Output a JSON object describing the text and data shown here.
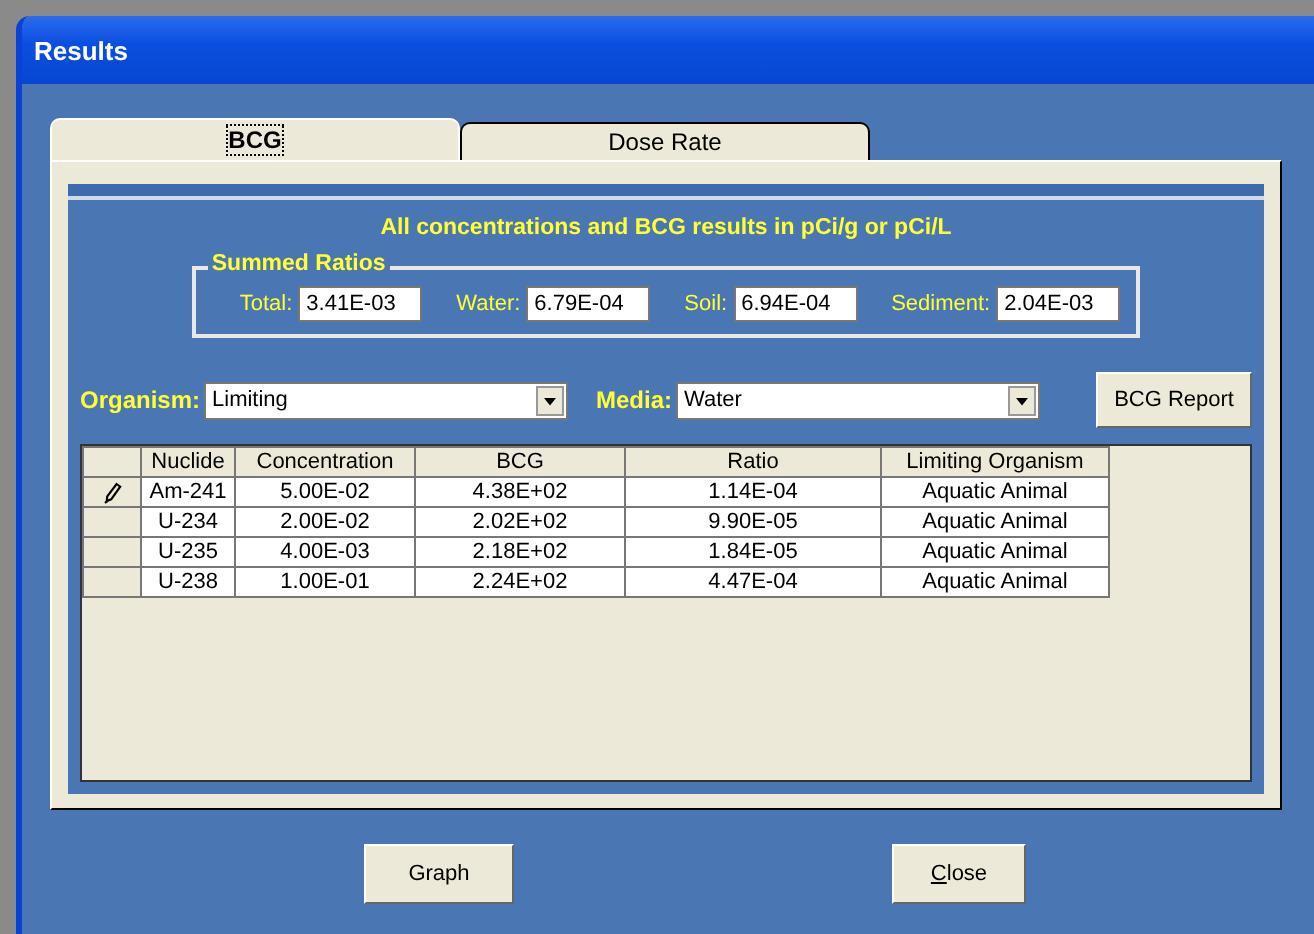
{
  "window": {
    "title": "Results"
  },
  "tabs": [
    {
      "label": "BCG",
      "selected": true
    },
    {
      "label": "Dose Rate",
      "selected": false
    }
  ],
  "heading": "All concentrations and BCG results in pCi/g or pCi/L",
  "summed_ratios": {
    "title": "Summed Ratios",
    "fields": [
      {
        "label": "Total:",
        "value": "3.41E-03"
      },
      {
        "label": "Water:",
        "value": "6.79E-04"
      },
      {
        "label": "Soil:",
        "value": "6.94E-04"
      },
      {
        "label": "Sediment:",
        "value": "2.04E-03"
      }
    ]
  },
  "organism": {
    "label": "Organism:",
    "value": "Limiting"
  },
  "media": {
    "label": "Media:",
    "value": "Water"
  },
  "report_button": "BCG Report",
  "table": {
    "columns": [
      "Nuclide",
      "Concentration",
      "BCG",
      "Ratio",
      "Limiting Organism"
    ],
    "rows": [
      {
        "editing": true,
        "cells": [
          "Am-241",
          "5.00E-02",
          "4.38E+02",
          "1.14E-04",
          "Aquatic Animal"
        ]
      },
      {
        "editing": false,
        "cells": [
          "U-234",
          "2.00E-02",
          "2.02E+02",
          "9.90E-05",
          "Aquatic Animal"
        ]
      },
      {
        "editing": false,
        "cells": [
          "U-235",
          "4.00E-03",
          "2.18E+02",
          "1.84E-05",
          "Aquatic Animal"
        ]
      },
      {
        "editing": false,
        "cells": [
          "U-238",
          "1.00E-01",
          "2.24E+02",
          "4.47E-04",
          "Aquatic Animal"
        ]
      }
    ]
  },
  "buttons": [
    "Graph",
    "Close"
  ]
}
